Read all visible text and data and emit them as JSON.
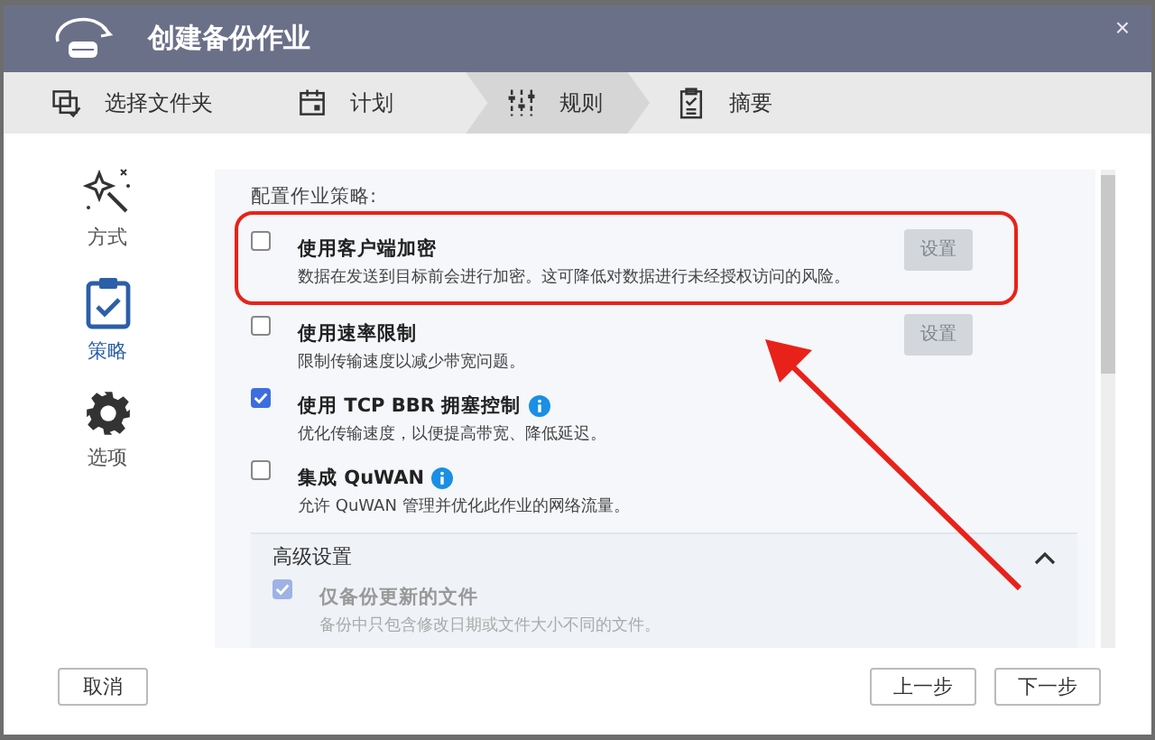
{
  "window": {
    "title": "创建备份作业",
    "close": "×"
  },
  "steps": [
    {
      "label": "选择文件夹",
      "selected": false
    },
    {
      "label": "计划",
      "selected": false
    },
    {
      "label": "规则",
      "selected": true
    },
    {
      "label": "摘要",
      "selected": false
    }
  ],
  "sidebar": {
    "items": [
      {
        "label": "方式",
        "selected": false
      },
      {
        "label": "策略",
        "selected": true
      },
      {
        "label": "选项",
        "selected": false
      }
    ]
  },
  "panel": {
    "heading": "配置作业策略:",
    "options": [
      {
        "title": "使用客户端加密",
        "description": "数据在发送到目标前会进行加密。这可降低对数据进行未经授权访问的风险。",
        "checked": false,
        "info": false,
        "button": {
          "label": "设置",
          "disabled": true
        },
        "highlighted": true
      },
      {
        "title": "使用速率限制",
        "description": "限制传输速度以减少带宽问题。",
        "checked": false,
        "info": false,
        "button": {
          "label": "设置",
          "disabled": true
        },
        "highlighted": false
      },
      {
        "title": "使用 TCP BBR 拥塞控制",
        "description": "优化传输速度，以便提高带宽、降低延迟。",
        "checked": true,
        "info": true,
        "highlighted": false
      },
      {
        "title": "集成 QuWAN",
        "description": "允许 QuWAN 管理并优化此作业的网络流量。",
        "checked": false,
        "info": true,
        "highlighted": false
      }
    ],
    "advanced": {
      "title": "高级设置",
      "expanded": true,
      "options": [
        {
          "title": "仅备份更新的文件",
          "description": "备份中只包含修改日期或文件大小不同的文件。",
          "checked": true,
          "disabled": true
        }
      ]
    }
  },
  "footer": {
    "cancel": "取消",
    "back": "上一步",
    "next": "下一步"
  }
}
